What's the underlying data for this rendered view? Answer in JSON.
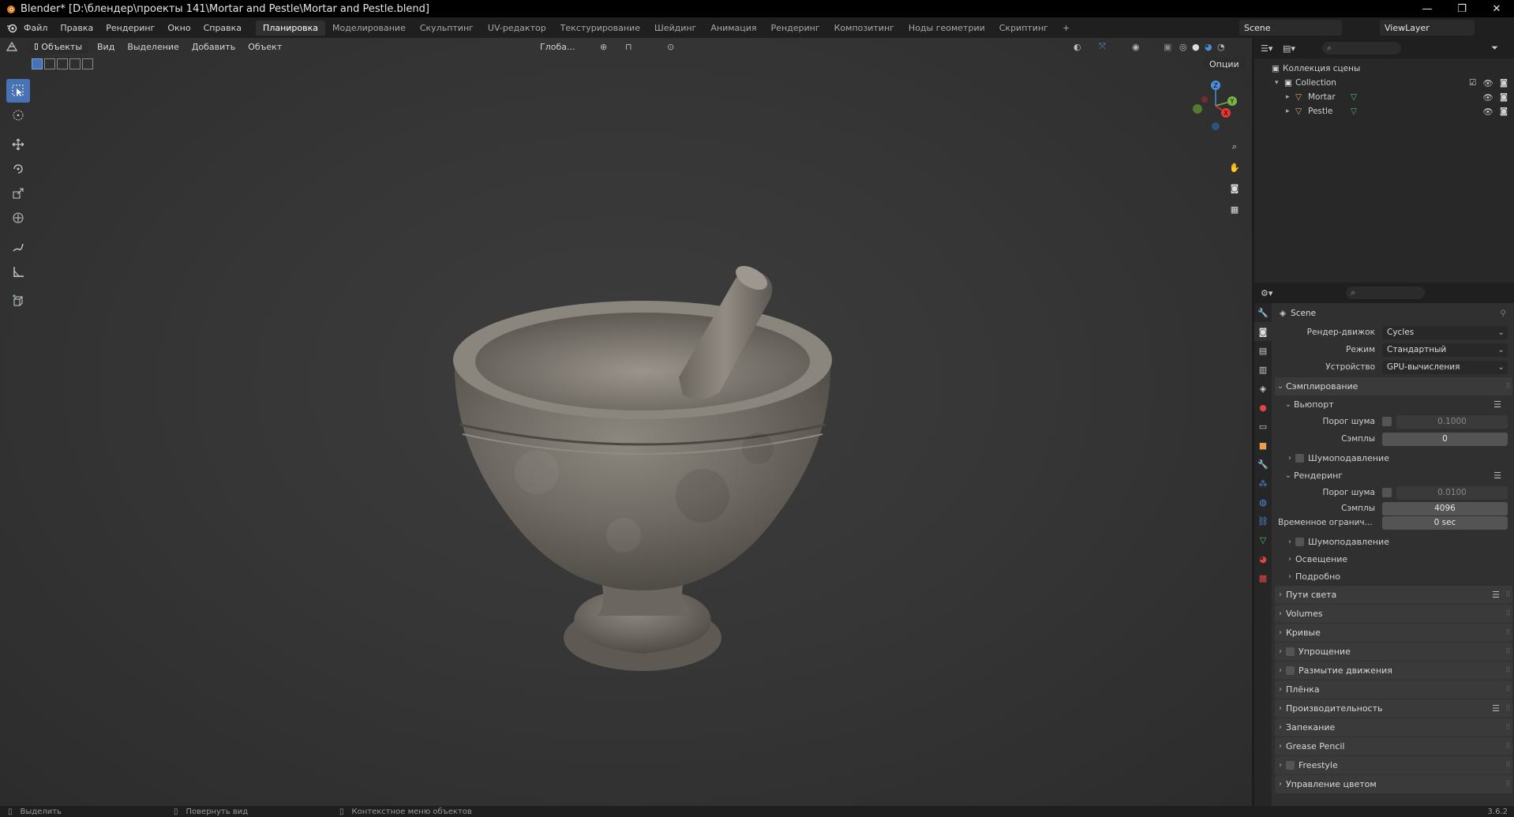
{
  "window": {
    "title": "Blender* [D:\\блендер\\проекты 141\\Mortar and Pestle\\Mortar and Pestle.blend]",
    "controls": [
      "—",
      "❐",
      "✕"
    ]
  },
  "menu": [
    "Файл",
    "Правка",
    "Рендеринг",
    "Окно",
    "Справка"
  ],
  "workspaces": [
    "Планировка",
    "Моделирование",
    "Скульптинг",
    "UV-редактор",
    "Текстурирование",
    "Шейдинг",
    "Анимация",
    "Рендеринг",
    "Композитинг",
    "Ноды геометрии",
    "Скриптинг",
    "+"
  ],
  "active_workspace": "Планировка",
  "scene_name": "Scene",
  "view_layer": "ViewLayer",
  "viewport_header": {
    "mode": "Объекты",
    "items": [
      "Вид",
      "Выделение",
      "Добавить",
      "Объект"
    ],
    "orientation": "Глоба...",
    "options": "Опции"
  },
  "outliner": {
    "root": "Коллекция сцены",
    "collection": "Collection",
    "objects": [
      "Mortar",
      "Pestle"
    ]
  },
  "properties": {
    "scene": "Scene",
    "render_engine_label": "Рендер-движок",
    "render_engine": "Cycles",
    "mode_label": "Режим",
    "mode": "Стандартный",
    "device_label": "Устройство",
    "device": "GPU-вычисления",
    "sampling": "Сэмплирование",
    "viewport": "Вьюпорт",
    "noise_threshold_label": "Порог шума",
    "viewport_noise": "0.1000",
    "samples_label": "Сэмплы",
    "viewport_samples": "0",
    "denoise": "Шумоподавление",
    "render": "Рендеринг",
    "render_noise": "0.0100",
    "render_samples": "4096",
    "time_limit_label": "Временное огранич...",
    "time_limit": "0 sec",
    "lighting": "Освещение",
    "advanced": "Подробно",
    "panels": [
      "Пути света",
      "Volumes",
      "Кривые",
      "Упрощение",
      "Размытие движения",
      "Плёнка",
      "Производительность",
      "Запекание",
      "Grease Pencil",
      "Freestyle",
      "Управление цветом"
    ]
  },
  "status": {
    "select": "Выделить",
    "rotate": "Повернуть вид",
    "context": "Контекстное меню объектов",
    "version": "3.6.2"
  },
  "gizmo": {
    "z": "Z",
    "y": "Y",
    "x": "X"
  }
}
